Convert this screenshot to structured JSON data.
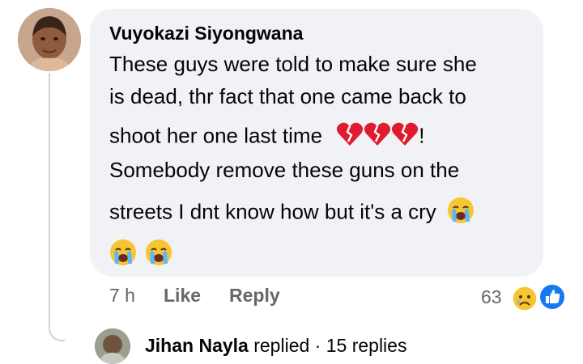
{
  "comment": {
    "author": "Vuyokazi Siyongwana",
    "lines": [
      "These guys were told to make sure she",
      "is dead, thr fact that one came back to",
      "shoot her one last time",
      "Somebody remove these guns on the",
      "streets I dnt know how but it's a cry"
    ],
    "line3_suffix": "!",
    "emojis": {
      "line3": [
        "broken-heart-icon",
        "broken-heart-icon",
        "broken-heart-icon"
      ],
      "line5": [
        "crying-face-icon"
      ],
      "line6": [
        "crying-face-icon",
        "crying-face-icon"
      ]
    }
  },
  "actions": {
    "time": "7 h",
    "like_label": "Like",
    "reply_label": "Reply",
    "reaction_count": "63",
    "reaction_icons": [
      "sad-face-icon",
      "thumbs-up-icon"
    ]
  },
  "reply_preview": {
    "name": "Jihan Nayla",
    "verb": "replied",
    "separator": "·",
    "count_text": "15 replies"
  },
  "colors": {
    "bubble": "#f0f2f5",
    "muted_text": "#65676b",
    "like_blue": "#1877f2"
  }
}
